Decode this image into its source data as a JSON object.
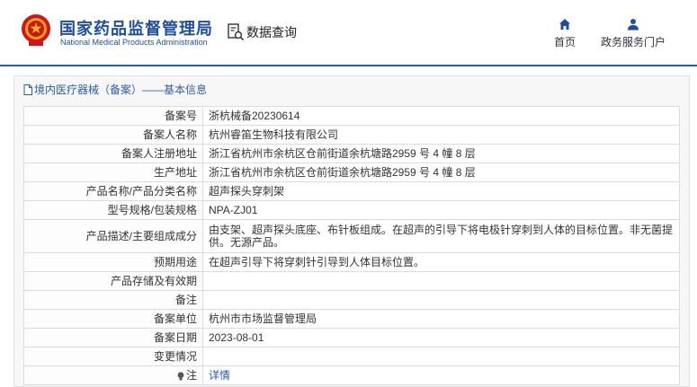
{
  "header": {
    "site_title": "国家药品监督管理局",
    "site_subtitle": "National Medical Products Administration",
    "query_label": "数据查询",
    "nav": [
      {
        "label": "首页",
        "icon": "home-icon"
      },
      {
        "label": "政务服务门户",
        "icon": "user-icon"
      }
    ]
  },
  "breadcrumb": "境内医疗器械（备案）——基本信息",
  "rows": [
    {
      "label": "备案号",
      "value": "浙杭械备20230614"
    },
    {
      "label": "备案人名称",
      "value": "杭州睿笛生物科技有限公司"
    },
    {
      "label": "备案人注册地址",
      "value": "浙江省杭州市余杭区仓前街道余杭塘路2959 号 4 幢 8 层"
    },
    {
      "label": "生产地址",
      "value": "浙江省杭州市余杭区仓前街道余杭塘路2959 号 4 幢 8 层"
    },
    {
      "label": "产品名称/产品分类名称",
      "value": "超声探头穿刺架"
    },
    {
      "label": "型号规格/包装规格",
      "value": "NPA-ZJ01"
    },
    {
      "label": "产品描述/主要组成成分",
      "value": "由支架、超声探头底座、布针板组成。在超声的引导下将电极针穿刺到人体的目标位置。非无菌提供。无源产品。"
    },
    {
      "label": "预期用途",
      "value": "在超声引导下将穿刺针引导到人体目标位置。"
    },
    {
      "label": "产品存储及有效期",
      "value": ""
    },
    {
      "label": "备注",
      "value": ""
    },
    {
      "label": "备案单位",
      "value": "杭州市市场监督管理局"
    },
    {
      "label": "备案日期",
      "value": "2023-08-01"
    },
    {
      "label": "变更情况",
      "value": ""
    },
    {
      "label": "注",
      "value": "详情"
    }
  ],
  "colors": {
    "brand_blue": "#1f4e9c",
    "link_blue": "#2a5da8"
  }
}
